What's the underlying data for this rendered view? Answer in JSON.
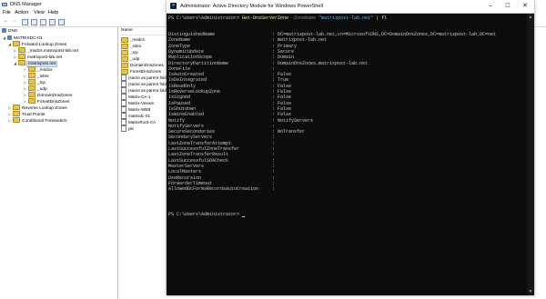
{
  "dns_manager": {
    "title": "DNS Manager",
    "menu": [
      "File",
      "Action",
      "View",
      "Help"
    ],
    "tree": [
      {
        "label": "DNS",
        "depth": 0,
        "icon": "dns"
      },
      {
        "label": "MATRIXDC-01",
        "depth": 1,
        "icon": "server",
        "expanded": true
      },
      {
        "label": "Forward Lookup Zones",
        "depth": 2,
        "icon": "folder",
        "expanded": true
      },
      {
        "label": "_msdcs.matrixpost-lab.net",
        "depth": 3,
        "icon": "zone",
        "expanded": false
      },
      {
        "label": "matrixpost-lab.net",
        "depth": 3,
        "icon": "zone",
        "expanded": true
      },
      {
        "label": "matrixpost.net",
        "depth": 3,
        "icon": "zone",
        "expanded": true,
        "selected": true
      },
      {
        "label": "_msdcs",
        "depth": 4,
        "icon": "folder"
      },
      {
        "label": "_sites",
        "depth": 4,
        "icon": "folder"
      },
      {
        "label": "_tcp",
        "depth": 4,
        "icon": "folder"
      },
      {
        "label": "_udp",
        "depth": 4,
        "icon": "folder"
      },
      {
        "label": "DomainDnsZones",
        "depth": 4,
        "icon": "folder"
      },
      {
        "label": "ForestDnsZones",
        "depth": 4,
        "icon": "folder"
      },
      {
        "label": "Reverse Lookup Zones",
        "depth": 2,
        "icon": "folder"
      },
      {
        "label": "Trust Points",
        "depth": 2,
        "icon": "folder"
      },
      {
        "label": "Conditional Forwarders",
        "depth": 2,
        "icon": "folder"
      }
    ],
    "pane": {
      "column_header": "Name",
      "items": [
        {
          "label": "_msdcs",
          "icon": "folder"
        },
        {
          "label": "_sites",
          "icon": "folder"
        },
        {
          "label": "_tcp",
          "icon": "folder"
        },
        {
          "label": "_udp",
          "icon": "folder"
        },
        {
          "label": "DomainDnsZones",
          "icon": "folder"
        },
        {
          "label": "ForestDnsZones",
          "icon": "folder"
        },
        {
          "label": "(same as parent fold",
          "icon": "record"
        },
        {
          "label": "(same as parent fold",
          "icon": "record"
        },
        {
          "label": "(same as parent fold",
          "icon": "record"
        },
        {
          "label": "Matrix-CA-1",
          "icon": "record"
        },
        {
          "label": "Matrix-Veeam",
          "icon": "record"
        },
        {
          "label": "Matrix-WEB",
          "icon": "record"
        },
        {
          "label": "matrixdc-01",
          "icon": "record"
        },
        {
          "label": "MatrixRoot-CA",
          "icon": "record"
        },
        {
          "label": "pki",
          "icon": "record"
        }
      ]
    }
  },
  "powershell": {
    "title": "Administrator: Active Directory Module for Windows PowerShell",
    "prompt": "PS C:\\Users\\Administrator>",
    "command": {
      "cmdlet": "Get-DnsServerZone",
      "param": "-ZoneName",
      "value": "\"matrixpost-lab.net\"",
      "pipe": "|",
      "alias": "fl"
    },
    "properties": [
      {
        "name": "DistinguishedName",
        "value": "DC=matrixpost-lab.net,cn=MicrosoftDNS,DC=DomainDnsZones,DC=matrixpost-lab,DC=net"
      },
      {
        "name": "ZoneName",
        "value": "matrixpost-lab.net"
      },
      {
        "name": "ZoneType",
        "value": "Primary"
      },
      {
        "name": "DynamicUpdate",
        "value": "Secure"
      },
      {
        "name": "ReplicationScope",
        "value": "Domain"
      },
      {
        "name": "DirectoryPartitionName",
        "value": "DomainDnsZones.matrixpost-lab.net"
      },
      {
        "name": "ZoneFile",
        "value": ""
      },
      {
        "name": "IsAutoCreated",
        "value": "False"
      },
      {
        "name": "IsDsIntegrated",
        "value": "True"
      },
      {
        "name": "IsReadOnly",
        "value": "False"
      },
      {
        "name": "IsReverseLookupZone",
        "value": "False"
      },
      {
        "name": "IsSigned",
        "value": "False"
      },
      {
        "name": "IsPaused",
        "value": "False"
      },
      {
        "name": "IsShutdown",
        "value": "False"
      },
      {
        "name": "IsWinsEnabled",
        "value": "False"
      },
      {
        "name": "Notify",
        "value": "NotifyServers"
      },
      {
        "name": "NotifyServers",
        "value": ""
      },
      {
        "name": "SecureSecondaries",
        "value": "NoTransfer"
      },
      {
        "name": "SecondaryServers",
        "value": ""
      },
      {
        "name": "LastZoneTransferAttempt",
        "value": ""
      },
      {
        "name": "LastSuccessfulZoneTransfer",
        "value": ""
      },
      {
        "name": "LastZoneTransferResult",
        "value": ""
      },
      {
        "name": "LastSuccessfulSOACheck",
        "value": ""
      },
      {
        "name": "MasterServers",
        "value": ""
      },
      {
        "name": "LocalMasters",
        "value": ""
      },
      {
        "name": "UseRecursion",
        "value": ""
      },
      {
        "name": "ForwarderTimeout",
        "value": ""
      },
      {
        "name": "AllowedDcForNsRecordsAutoCreation",
        "value": ""
      }
    ]
  }
}
